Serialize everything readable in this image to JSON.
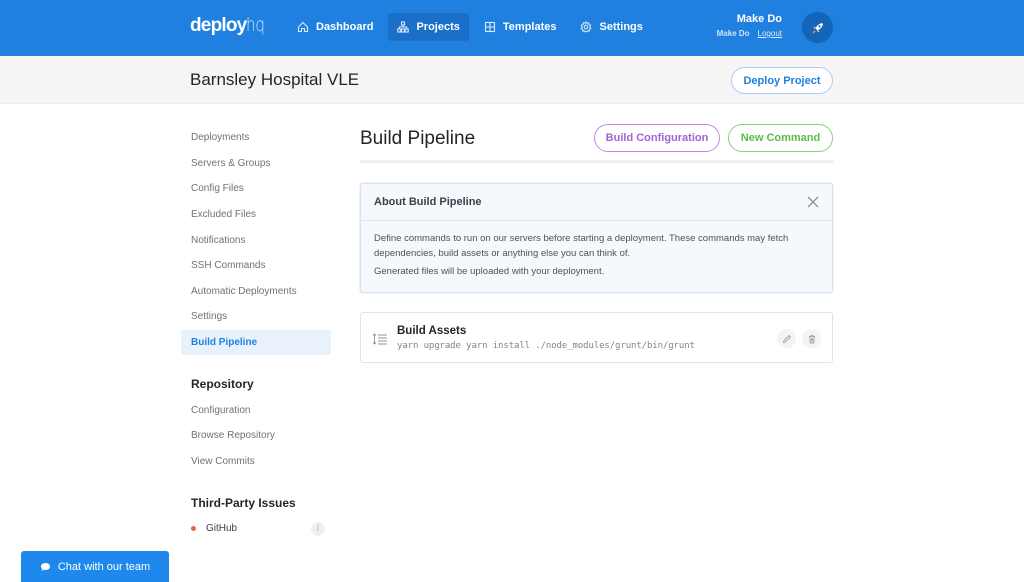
{
  "header": {
    "logo": {
      "bold": "deploy",
      "light": "hq"
    },
    "nav": [
      {
        "label": "Dashboard",
        "icon": "home-icon",
        "active": false
      },
      {
        "label": "Projects",
        "icon": "projects-icon",
        "active": true
      },
      {
        "label": "Templates",
        "icon": "templates-icon",
        "active": false
      },
      {
        "label": "Settings",
        "icon": "gear-icon",
        "active": false
      }
    ],
    "user": {
      "name": "Make Do",
      "account": "Make Do",
      "logout": "Logout",
      "avatar_icon": "rocket-icon"
    }
  },
  "project": {
    "title": "Barnsley Hospital VLE",
    "deploy_button": "Deploy Project"
  },
  "sidebar": {
    "items": [
      {
        "label": "Deployments",
        "active": false
      },
      {
        "label": "Servers & Groups",
        "active": false
      },
      {
        "label": "Config Files",
        "active": false
      },
      {
        "label": "Excluded Files",
        "active": false
      },
      {
        "label": "Notifications",
        "active": false
      },
      {
        "label": "SSH Commands",
        "active": false
      },
      {
        "label": "Automatic Deployments",
        "active": false
      },
      {
        "label": "Settings",
        "active": false
      },
      {
        "label": "Build Pipeline",
        "active": true
      }
    ],
    "repository": {
      "heading": "Repository",
      "items": [
        {
          "label": "Configuration"
        },
        {
          "label": "Browse Repository"
        },
        {
          "label": "View Commits"
        }
      ]
    },
    "third_party": {
      "heading": "Third-Party Issues",
      "items": [
        {
          "label": "GitHub",
          "status_color": "#e8654a"
        }
      ]
    }
  },
  "main": {
    "title": "Build Pipeline",
    "build_config_button": "Build Configuration",
    "new_command_button": "New Command",
    "about": {
      "title": "About Build Pipeline",
      "paragraphs": [
        "Define commands to run on our servers before starting a deployment. These commands may fetch dependencies, build assets or anything else you can think of.",
        "Generated files will be uploaded with your deployment."
      ]
    },
    "commands": [
      {
        "name": "Build Assets",
        "command": "yarn upgrade yarn install ./node_modules/grunt/bin/grunt"
      }
    ]
  },
  "chat": {
    "label": "Chat with our team"
  },
  "colors": {
    "brand": "#1f80e0",
    "purple": "#a363d6",
    "green": "#5cbb4b",
    "github_status": "#e8654a"
  }
}
